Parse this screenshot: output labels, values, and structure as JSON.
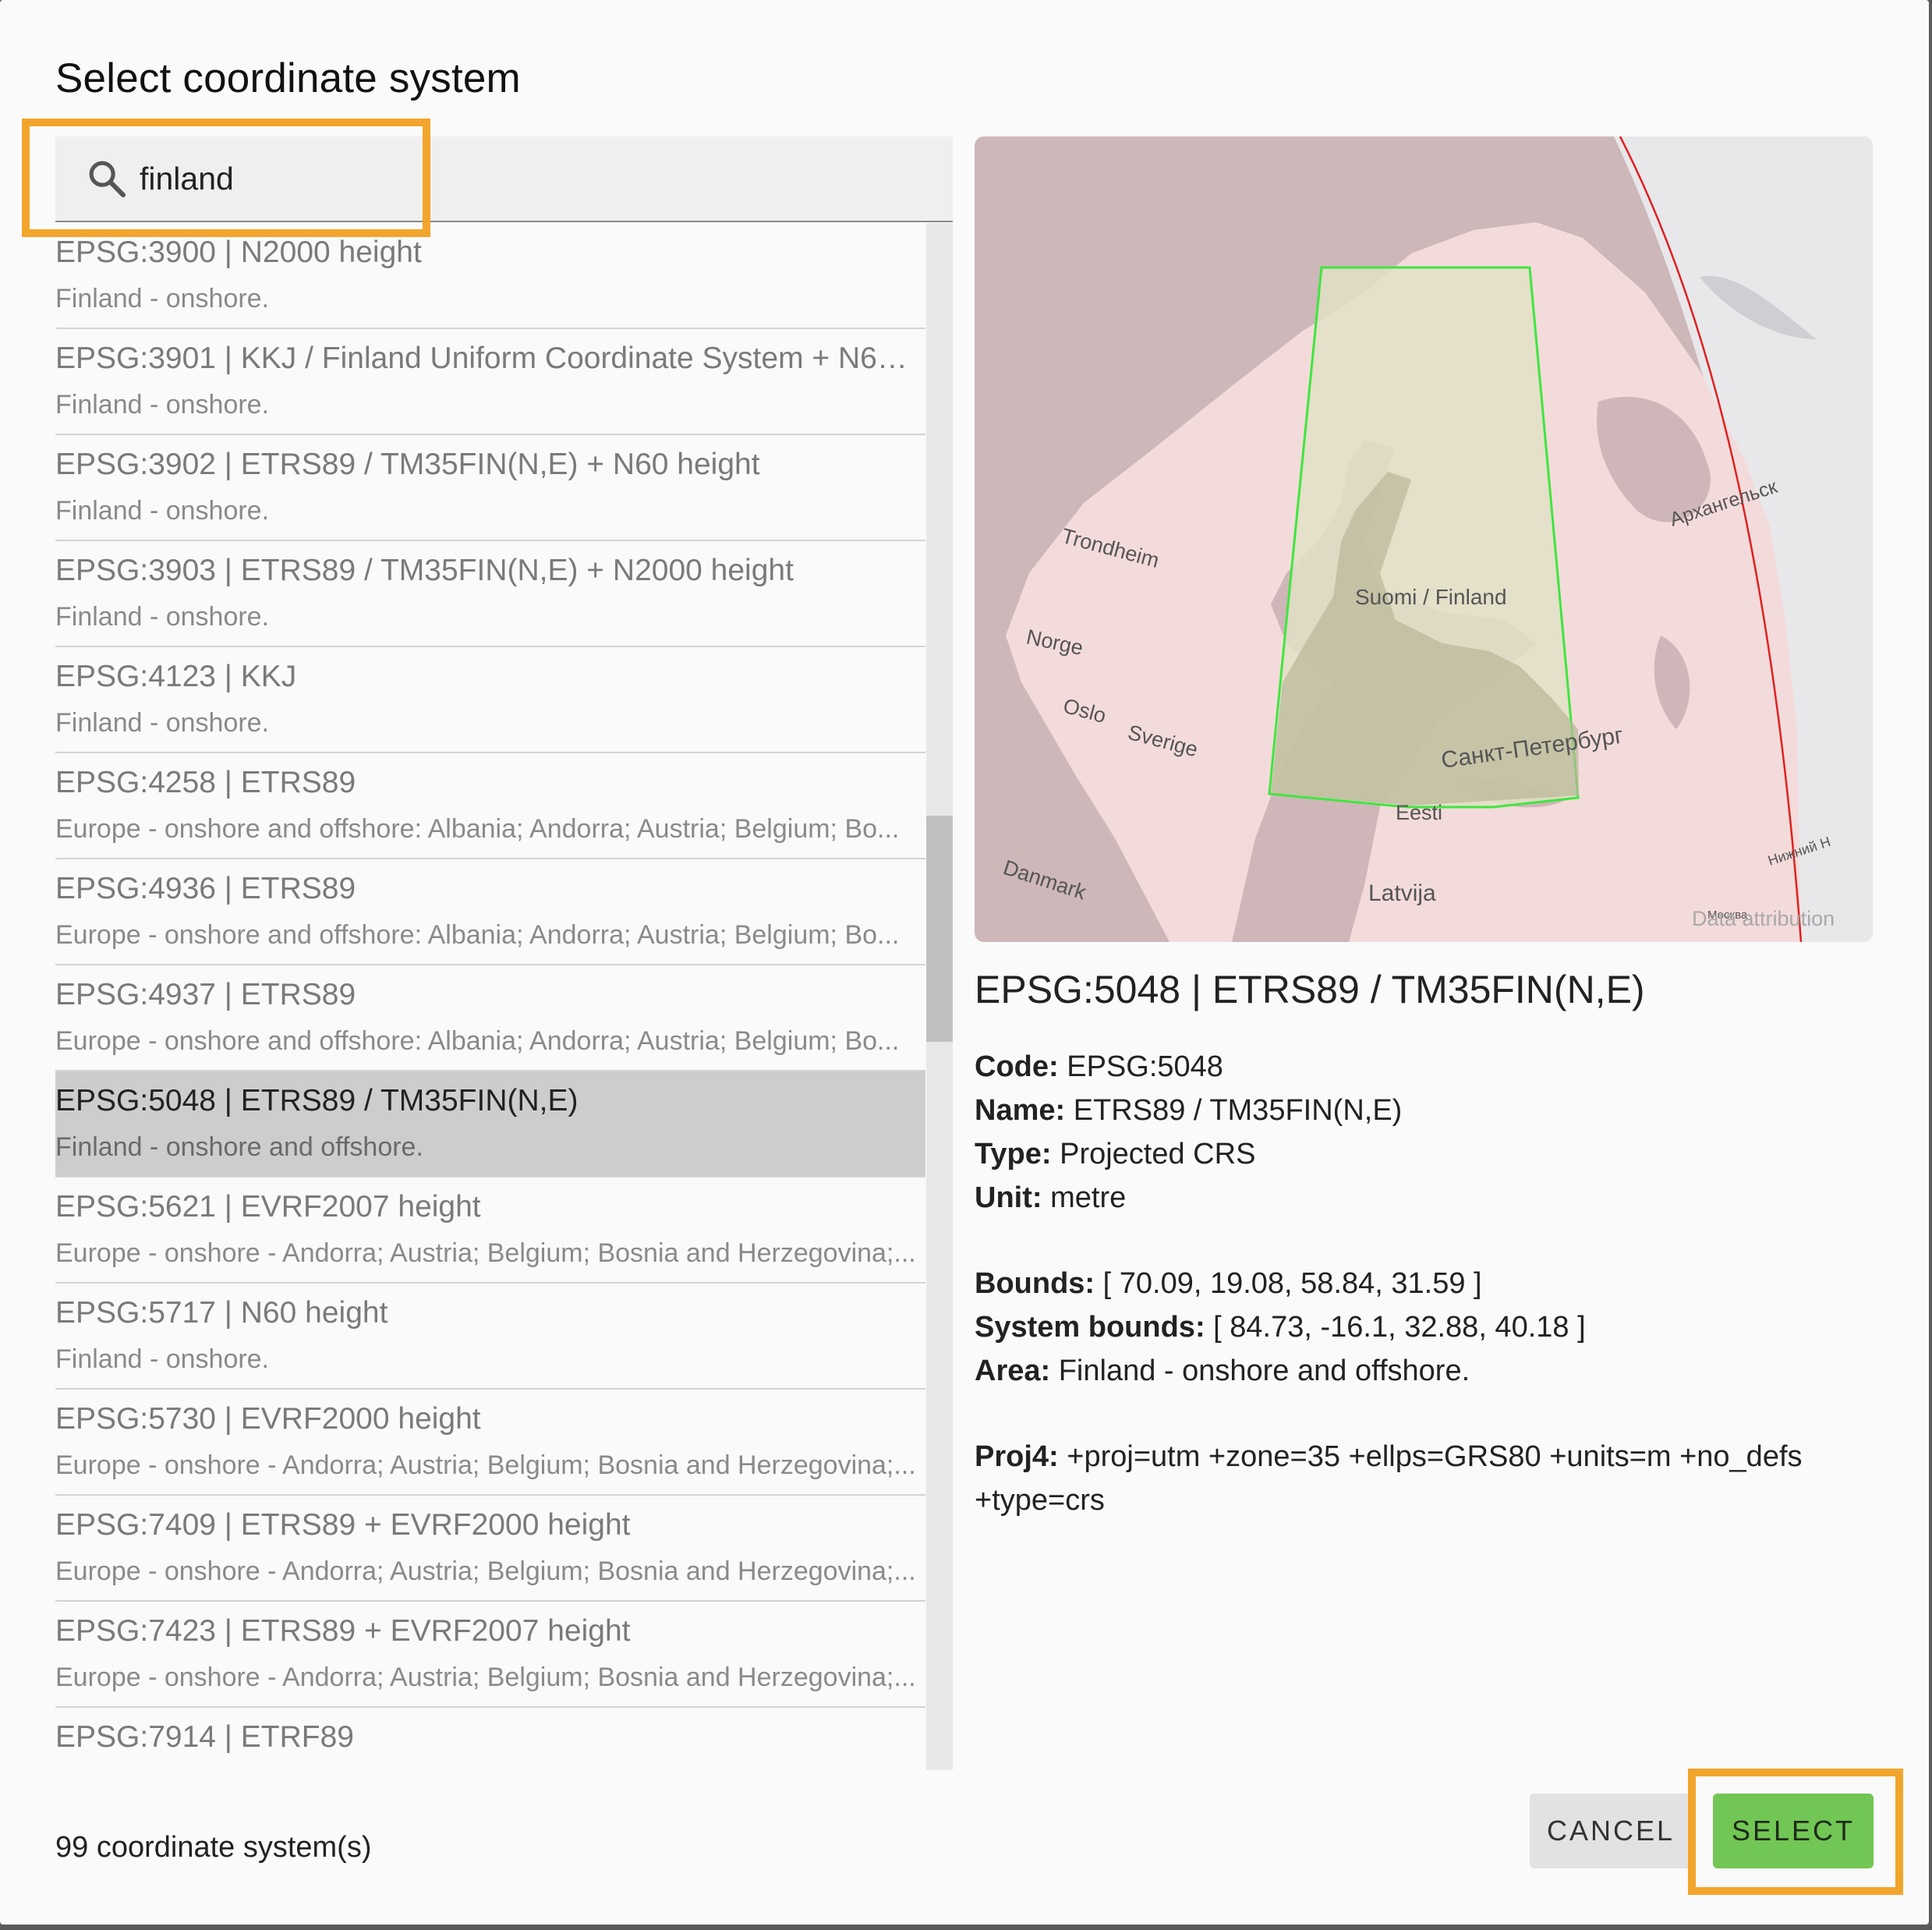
{
  "dialog": {
    "title": "Select coordinate system",
    "search": {
      "value": "finland"
    },
    "count_label": "99 coordinate system(s)",
    "list": [
      {
        "title": "EPSG:3900 | N2000 height",
        "area": "Finland - onshore."
      },
      {
        "title": "EPSG:3901 | KKJ / Finland Uniform Coordinate System + N60 ...",
        "area": "Finland - onshore."
      },
      {
        "title": "EPSG:3902 | ETRS89 / TM35FIN(N,E) + N60 height",
        "area": "Finland - onshore."
      },
      {
        "title": "EPSG:3903 | ETRS89 / TM35FIN(N,E) + N2000 height",
        "area": "Finland - onshore."
      },
      {
        "title": "EPSG:4123 | KKJ",
        "area": "Finland - onshore."
      },
      {
        "title": "EPSG:4258 | ETRS89",
        "area": "Europe - onshore and offshore: Albania; Andorra; Austria; Belgium; Bo..."
      },
      {
        "title": "EPSG:4936 | ETRS89",
        "area": "Europe - onshore and offshore: Albania; Andorra; Austria; Belgium; Bo..."
      },
      {
        "title": "EPSG:4937 | ETRS89",
        "area": "Europe - onshore and offshore: Albania; Andorra; Austria; Belgium; Bo..."
      },
      {
        "title": "EPSG:5048 | ETRS89 / TM35FIN(N,E)",
        "area": "Finland - onshore and offshore."
      },
      {
        "title": "EPSG:5621 | EVRF2007 height",
        "area": "Europe - onshore - Andorra; Austria; Belgium; Bosnia and Herzegovina;..."
      },
      {
        "title": "EPSG:5717 | N60 height",
        "area": "Finland - onshore."
      },
      {
        "title": "EPSG:5730 | EVRF2000 height",
        "area": "Europe - onshore - Andorra; Austria; Belgium; Bosnia and Herzegovina;..."
      },
      {
        "title": "EPSG:7409 | ETRS89 + EVRF2000 height",
        "area": "Europe - onshore - Andorra; Austria; Belgium; Bosnia and Herzegovina;..."
      },
      {
        "title": "EPSG:7423 | ETRS89 + EVRF2007 height",
        "area": "Europe - onshore - Andorra; Austria; Belgium; Bosnia and Herzegovina;..."
      },
      {
        "title": "EPSG:7914 | ETRF89",
        "area": ""
      }
    ],
    "selected_index": 8
  },
  "map": {
    "labels": {
      "trondheim": "Trondheim",
      "norge": "Norge",
      "oslo": "Oslo",
      "sverige": "Sverige",
      "suomi": "Suomi / Finland",
      "spb": "Санкт-Петербург",
      "eesti": "Eesti",
      "danmark": "Danmark",
      "latvija": "Latvija",
      "arkhangelsk": "Архангельск",
      "nizhny": "Нижний Н",
      "moskva": "Москва"
    },
    "attribution": "Data attribution",
    "colors": {
      "area_outline": "#3fe63f",
      "system_boundary": "#e02020"
    }
  },
  "details": {
    "heading": "EPSG:5048 | ETRS89 / TM35FIN(N,E)",
    "code_label": "Code:",
    "code": "EPSG:5048",
    "name_label": "Name:",
    "name": "ETRS89 / TM35FIN(N,E)",
    "type_label": "Type:",
    "type": "Projected CRS",
    "unit_label": "Unit:",
    "unit": "metre",
    "bounds_label": "Bounds:",
    "bounds": "[ 70.09, 19.08, 58.84, 31.59 ]",
    "sysbounds_label": "System bounds:",
    "sysbounds": "[ 84.73, -16.1, 32.88, 40.18 ]",
    "area_label": "Area:",
    "area": "Finland - onshore and offshore.",
    "proj_label": "Proj4:",
    "proj": "+proj=utm +zone=35 +ellps=GRS80 +units=m +no_defs +type=crs"
  },
  "buttons": {
    "cancel": "CANCEL",
    "select": "SELECT"
  },
  "theme": {
    "accent_highlight": "#f2a52c",
    "select_button": "#72c654"
  }
}
